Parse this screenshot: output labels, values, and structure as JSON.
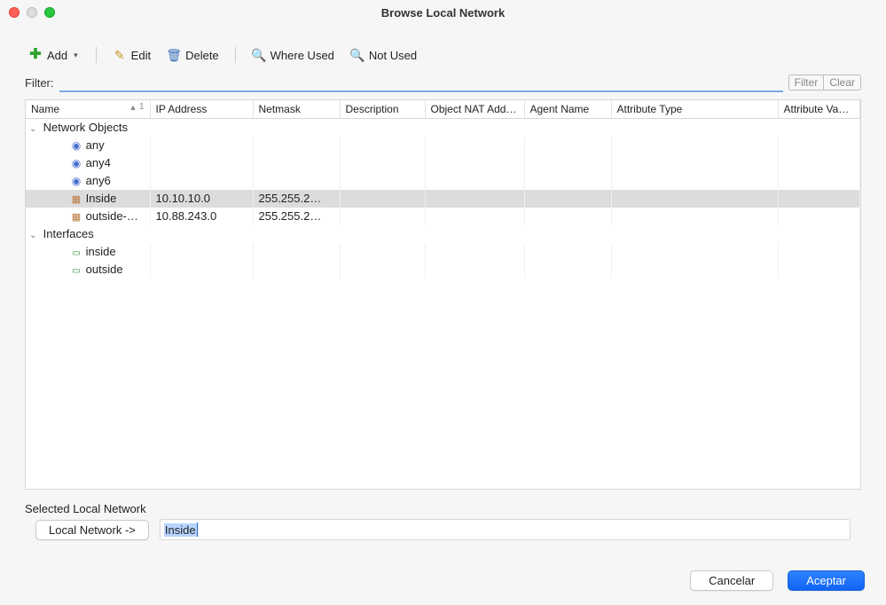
{
  "window": {
    "title": "Browse Local Network"
  },
  "toolbar": {
    "add": "Add",
    "edit": "Edit",
    "delete": "Delete",
    "where_used": "Where Used",
    "not_used": "Not Used"
  },
  "filter": {
    "label": "Filter:",
    "value": "",
    "filter_btn": "Filter",
    "clear_btn": "Clear"
  },
  "columns": {
    "name": "Name",
    "sort": {
      "dir": "▲",
      "num": "1"
    },
    "ip": "IP Address",
    "mask": "Netmask",
    "desc": "Description",
    "nat": "Object NAT Add…",
    "agent": "Agent Name",
    "atype": "Attribute Type",
    "aval": "Attribute Va…"
  },
  "groups": [
    {
      "label": "Network Objects",
      "rows": [
        {
          "icon": "globe",
          "name": "any",
          "ip": "",
          "mask": "",
          "sel": false
        },
        {
          "icon": "globe",
          "name": "any4",
          "ip": "",
          "mask": "",
          "sel": false
        },
        {
          "icon": "globe",
          "name": "any6",
          "ip": "",
          "mask": "",
          "sel": false
        },
        {
          "icon": "net",
          "name": "Inside",
          "ip": "10.10.10.0",
          "mask": "255.255.2…",
          "sel": true
        },
        {
          "icon": "net",
          "name": "outside-…",
          "ip": "10.88.243.0",
          "mask": "255.255.2…",
          "sel": false
        }
      ]
    },
    {
      "label": "Interfaces",
      "rows": [
        {
          "icon": "if",
          "name": "inside",
          "ip": "",
          "mask": "",
          "sel": false
        },
        {
          "icon": "if",
          "name": "outside",
          "ip": "",
          "mask": "",
          "sel": false
        }
      ]
    }
  ],
  "selected": {
    "section_label": "Selected Local Network",
    "button": "Local Network ->",
    "value": "Inside"
  },
  "actions": {
    "cancel": "Cancelar",
    "ok": "Aceptar"
  }
}
